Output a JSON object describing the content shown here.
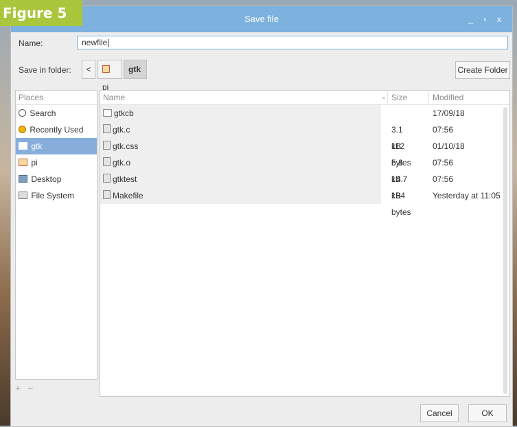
{
  "figure_label": "Figure 5",
  "window": {
    "title": "Save file",
    "controls": "_ ▫ x"
  },
  "name_row": {
    "label": "Name:",
    "value": "newfile"
  },
  "folder_row": {
    "label": "Save in folder:",
    "back": "<",
    "crumbs": [
      "pi",
      "gtk"
    ],
    "create_folder": "Create Folder"
  },
  "places": {
    "header": "Places",
    "items": [
      {
        "label": "Search",
        "icon": "search-icon"
      },
      {
        "label": "Recently Used",
        "icon": "clock-icon"
      },
      {
        "label": "gtk",
        "icon": "folder-icon",
        "selected": true
      },
      {
        "label": "pi",
        "icon": "home-icon"
      },
      {
        "label": "Desktop",
        "icon": "desktop-icon"
      },
      {
        "label": "File System",
        "icon": "drive-icon"
      }
    ],
    "add": "+",
    "remove": "−"
  },
  "files": {
    "headers": {
      "name": "Name",
      "size": "Size",
      "modified": "Modified"
    },
    "rows": [
      {
        "name": "gtkcb",
        "size": "",
        "modified": "17/09/18",
        "icon": "folder-icon"
      },
      {
        "name": "gtk.c",
        "size": "3.1 kB",
        "modified": "07:56",
        "icon": "text-file-icon"
      },
      {
        "name": "gtk.css",
        "size": "112 bytes",
        "modified": "01/10/18",
        "icon": "text-file-icon"
      },
      {
        "name": "gtk.o",
        "size": "5.8 kB",
        "modified": "07:56",
        "icon": "binary-file-icon"
      },
      {
        "name": "gtktest",
        "size": "14.7 kB",
        "modified": "07:56",
        "icon": "executable-icon"
      },
      {
        "name": "Makefile",
        "size": "194 bytes",
        "modified": "Yesterday at 11:05",
        "icon": "text-file-icon"
      }
    ]
  },
  "buttons": {
    "cancel": "Cancel",
    "ok": "OK"
  },
  "colors": {
    "accent": "#7db1de",
    "selection": "#87aedb",
    "figure_label_bg": "#a9c63d"
  }
}
